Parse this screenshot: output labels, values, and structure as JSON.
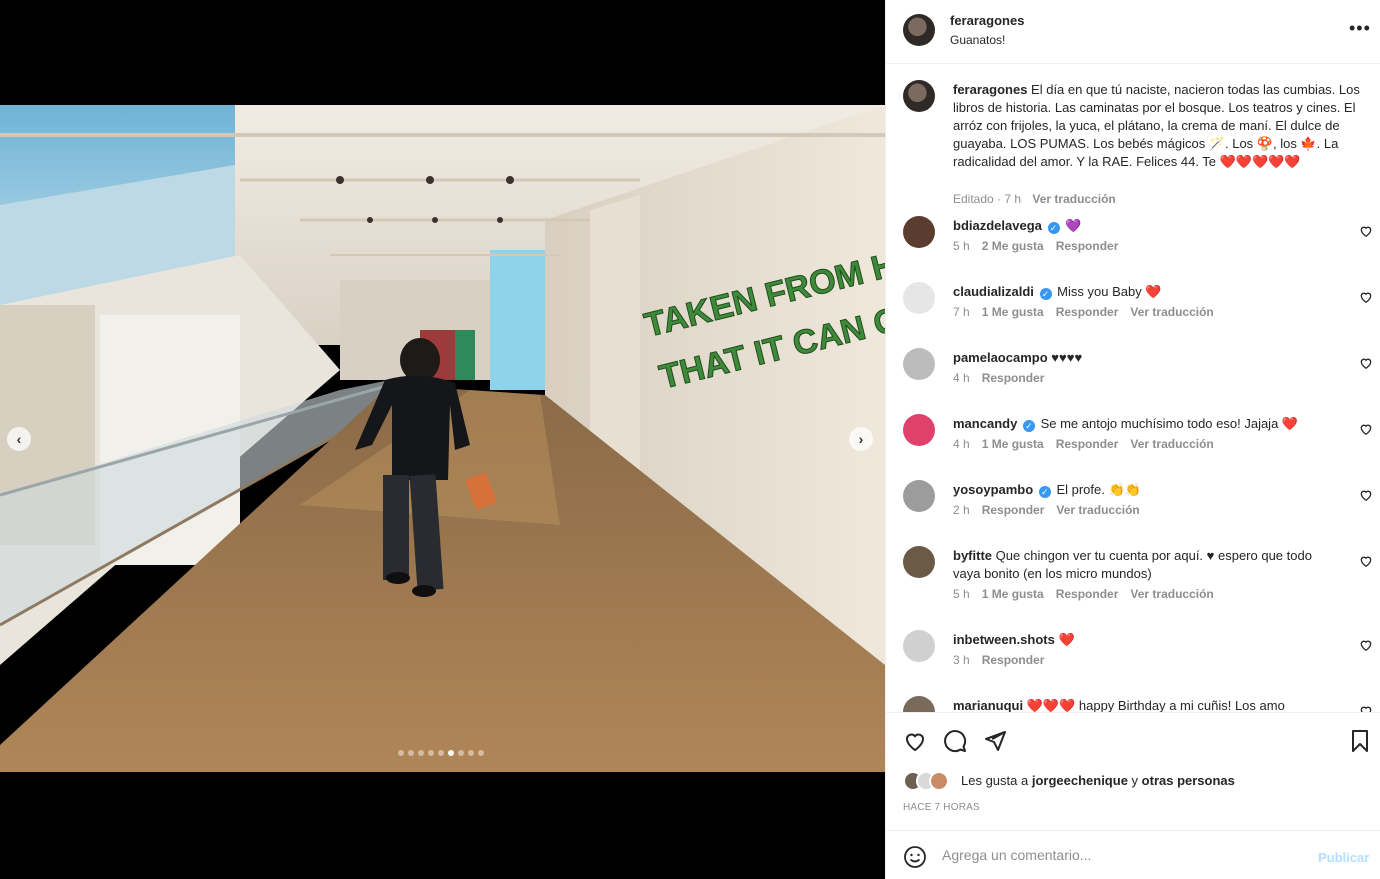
{
  "post": {
    "username": "feraragones",
    "location": "Guanatos!",
    "more_label": "•••"
  },
  "photo": {
    "wall_text_line1": "TAKEN FROM HERE TO WHERE",
    "wall_text_line2": "THAT IT CAN ONLY REMAIN AS",
    "slide_count": 9,
    "active_slide": 6,
    "prev_arrow": "‹",
    "next_arrow": "›"
  },
  "caption": {
    "username": "feraragones",
    "text": "El día en que tú naciste, nacieron todas las cumbias. Los libros de historia. Las caminatas por el bosque. Los teatros y cines. El arróz con frijoles, la yuca, el plátano, la crema de maní. El dulce de guayaba. LOS PUMAS. Los bebés mágicos 🪄. Los 🍄, los 🍁. La radicalidad del amor. Y la RAE. Felices 44. Te ❤️❤️❤️❤️❤️",
    "edited": "Editado · 7 h",
    "translate": "Ver traducción"
  },
  "comments": [
    {
      "username": "bdiazdelavega",
      "verified": true,
      "text": "💜",
      "time": "5 h",
      "likes": "2 Me gusta",
      "reply": "Responder",
      "translate": ""
    },
    {
      "username": "claudializaldi",
      "verified": true,
      "text": "Miss you Baby ❤️",
      "time": "7 h",
      "likes": "1 Me gusta",
      "reply": "Responder",
      "translate": "Ver traducción"
    },
    {
      "username": "pamelaocampo",
      "verified": false,
      "text": "♥♥♥♥",
      "time": "4 h",
      "likes": "",
      "reply": "Responder",
      "translate": ""
    },
    {
      "username": "mancandy",
      "verified": true,
      "text": "Se me antojo muchísimo todo eso! Jajaja ❤️",
      "time": "4 h",
      "likes": "1 Me gusta",
      "reply": "Responder",
      "translate": "Ver traducción"
    },
    {
      "username": "yosoypambo",
      "verified": true,
      "text": "El profe. 👏👏",
      "time": "2 h",
      "likes": "",
      "reply": "Responder",
      "translate": "Ver traducción"
    },
    {
      "username": "byfitte",
      "verified": false,
      "text": "Que chingon ver tu cuenta por aquí. ♥ espero que todo vaya bonito (en los micro mundos)",
      "time": "5 h",
      "likes": "1 Me gusta",
      "reply": "Responder",
      "translate": "Ver traducción"
    },
    {
      "username": "inbetween.shots",
      "verified": false,
      "text": "❤️",
      "time": "3 h",
      "likes": "",
      "reply": "Responder",
      "translate": ""
    },
    {
      "username": "marianuqui",
      "verified": false,
      "text": "❤️❤️❤️ happy Birthday a mi cuñis! Los amo",
      "time": "",
      "likes": "",
      "reply": "",
      "translate": ""
    }
  ],
  "likes": {
    "prefix": "Les gusta a",
    "user": "jorgeechenique",
    "joiner": "y",
    "others": "otras personas"
  },
  "timestamp": "HACE 7 HORAS",
  "composer": {
    "emoji_icon": "emoji-icon",
    "placeholder": "Agrega un comentario...",
    "post_label": "Publicar"
  },
  "colors": {
    "link_blue": "#3897f0",
    "publish_disabled": "#b2dffc",
    "wall_text_green": "#3f8a3a",
    "heart_red": "#ed4956"
  }
}
